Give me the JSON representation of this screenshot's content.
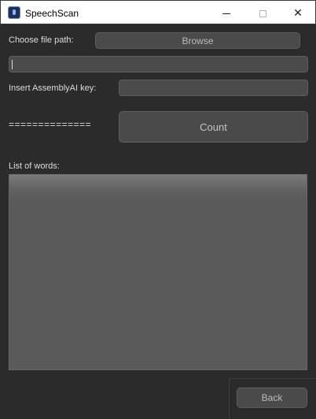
{
  "window": {
    "title": "SpeechScan",
    "icon": "speech-scan-app-icon"
  },
  "file_section": {
    "label": "Choose file path:",
    "browse_label": "Browse",
    "path_value": ""
  },
  "key_section": {
    "label": "Insert AssemblyAI key:",
    "key_value": ""
  },
  "count_section": {
    "separator": "==============",
    "count_label": "Count"
  },
  "words_section": {
    "label": "List of words:",
    "content": ""
  },
  "footer": {
    "back_label": "Back"
  },
  "colors": {
    "background": "#2b2b2b",
    "button": "#4a4a4a",
    "field": "#4b4b4b",
    "text": "#dcdcdc"
  }
}
